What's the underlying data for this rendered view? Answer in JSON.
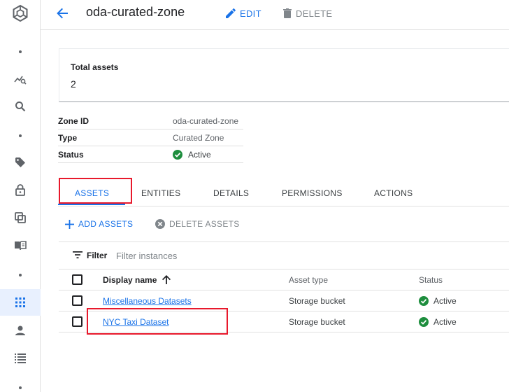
{
  "header": {
    "title": "oda-curated-zone",
    "edit_label": "EDIT",
    "delete_label": "DELETE"
  },
  "summary": {
    "total_assets_label": "Total assets",
    "total_assets_value": "2"
  },
  "zone_details": [
    {
      "key": "Zone ID",
      "value": "oda-curated-zone"
    },
    {
      "key": "Type",
      "value": "Curated Zone"
    },
    {
      "key": "Status",
      "value": "Active"
    }
  ],
  "tabs": [
    {
      "label": "ASSETS",
      "active": true
    },
    {
      "label": "ENTITIES",
      "active": false
    },
    {
      "label": "DETAILS",
      "active": false
    },
    {
      "label": "PERMISSIONS",
      "active": false
    },
    {
      "label": "ACTIONS",
      "active": false
    }
  ],
  "actions": {
    "add_label": "ADD ASSETS",
    "delete_label": "DELETE ASSETS"
  },
  "filter": {
    "label": "Filter",
    "placeholder": "Filter instances"
  },
  "table": {
    "columns": [
      "Display name",
      "Asset type",
      "Status"
    ],
    "sort": "ascending",
    "rows": [
      {
        "name": "Miscellaneous Datasets",
        "type": "Storage bucket",
        "status": "Active"
      },
      {
        "name": "NYC Taxi Dataset",
        "type": "Storage bucket",
        "status": "Active"
      }
    ]
  },
  "colors": {
    "accent": "#1a73e8",
    "success": "#1e8e3e",
    "highlight": "#e8192c"
  },
  "icons": [
    "dataplex-logo-icon",
    "dot-icon",
    "explore-icon",
    "search-icon",
    "tag-icon",
    "lock-icon",
    "copy-icon",
    "book-icon",
    "apps-grid-icon",
    "person-icon",
    "list-icon",
    "arrow-back-icon",
    "pencil-icon",
    "trash-icon",
    "plus-icon",
    "cancel-circle-icon",
    "filter-icon",
    "arrow-upward-icon",
    "check-circle-icon"
  ]
}
